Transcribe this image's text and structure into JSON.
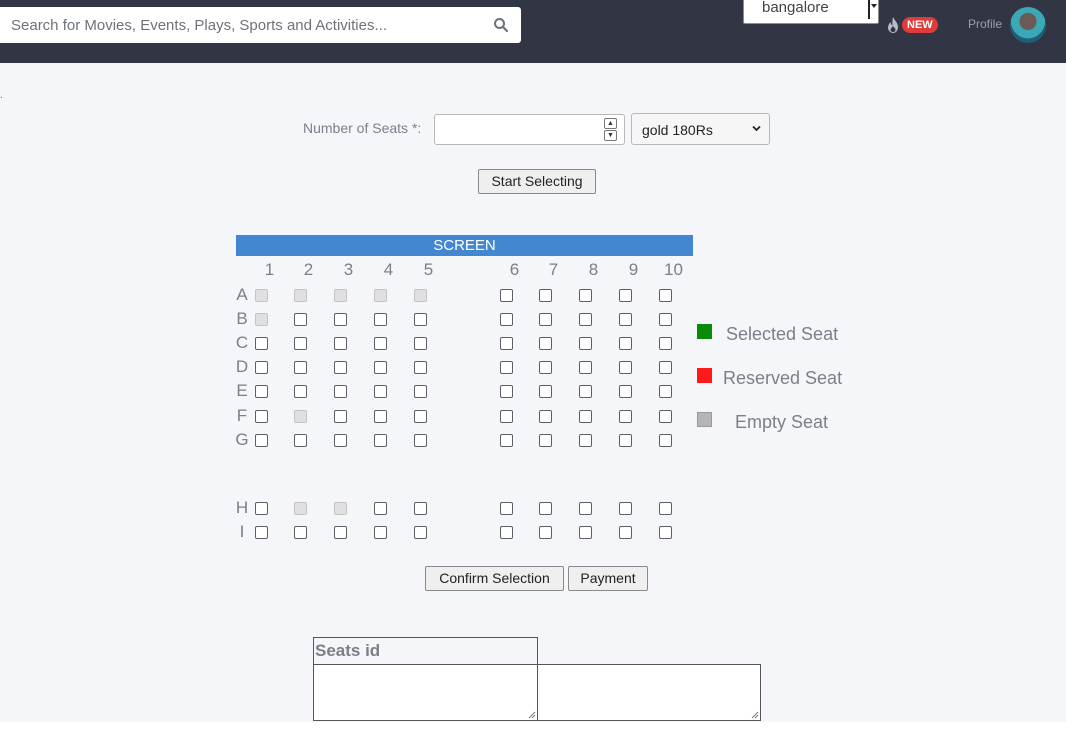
{
  "header": {
    "search_placeholder": "Search for Movies, Events, Plays, Sports and Activities...",
    "city": "bangalore",
    "new_badge": "NEW",
    "profile_label": "Profile"
  },
  "booking": {
    "seats_label": "Number of Seats *:",
    "seats_value": "",
    "class_selected": "gold 180Rs",
    "start_button": "Start Selecting",
    "screen_label": "SCREEN",
    "columns": [
      "1",
      "2",
      "3",
      "4",
      "5",
      "6",
      "7",
      "8",
      "9",
      "10"
    ],
    "rows": [
      "A",
      "B",
      "C",
      "D",
      "E",
      "F",
      "G",
      "H",
      "I"
    ],
    "disabled_seats": [
      "A1",
      "A2",
      "A3",
      "A4",
      "A5",
      "B1",
      "F2",
      "H2",
      "H3"
    ],
    "confirm_button": "Confirm Selection",
    "payment_button": "Payment"
  },
  "legend": {
    "selected": "Selected Seat",
    "reserved": "Reserved Seat",
    "empty": "Empty Seat",
    "selected_color": "#0a8a0a",
    "reserved_color": "#ff1a1a",
    "empty_color": "#b5b5b5"
  },
  "seats_table": {
    "header": "Seats id"
  }
}
